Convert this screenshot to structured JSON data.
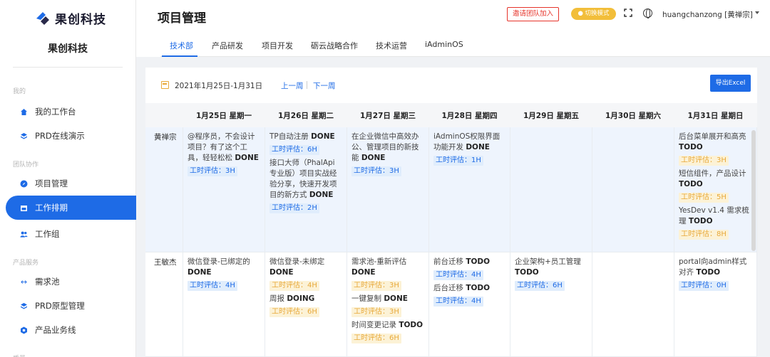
{
  "brand": {
    "logo_text": "果创科技",
    "org_name": "果创科技"
  },
  "sidebar": {
    "groups": [
      {
        "label": "我的",
        "items": [
          {
            "label": "我的工作台",
            "icon": "home-icon"
          },
          {
            "label": "PRD在线演示",
            "icon": "layers-icon"
          }
        ]
      },
      {
        "label": "团队协作",
        "items": [
          {
            "label": "项目管理",
            "icon": "compass-icon"
          },
          {
            "label": "工作排期",
            "icon": "calendar-icon",
            "active": true
          },
          {
            "label": "工作组",
            "icon": "group-icon"
          }
        ]
      },
      {
        "label": "产品服务",
        "items": [
          {
            "label": "需求池",
            "icon": "arrows-icon"
          },
          {
            "label": "PRD原型管理",
            "icon": "layers-icon"
          },
          {
            "label": "产品业务线",
            "icon": "hexagon-icon"
          }
        ]
      },
      {
        "label": "质量",
        "items": []
      }
    ]
  },
  "header": {
    "title": "项目管理",
    "invite_label": "邀请团队加入",
    "mode_label": "● 切换模式",
    "user_label": "huangchanzong [黄禅宗]"
  },
  "tabs": [
    "技术部",
    "产品研发",
    "项目开发",
    "砺云战略合作",
    "技术运营",
    "iAdminOS"
  ],
  "toolbar": {
    "date_range": "2021年1月25日-1月31日",
    "prev_week": "上一周",
    "next_week": "下一周",
    "export_label": "导出Excel"
  },
  "columns": [
    "1月25日 星期一",
    "1月26日 星期二",
    "1月27日 星期三",
    "1月28日 星期四",
    "1月29日 星期五",
    "1月30日 星期六",
    "1月31日 星期日"
  ],
  "rows": [
    {
      "name": "黄禅宗",
      "days": [
        [
          {
            "title": "@程序员，不会设计项目？有了这个工具，轻轻松松",
            "status": "DONE",
            "estimate": "工时评估：3H",
            "color": "blue"
          }
        ],
        [
          {
            "title": "TP自动注册",
            "status": "DONE",
            "estimate": "工时评估：6H",
            "color": "blue"
          },
          {
            "title": "接口大师（PhalApi专业版）项目实战经验分享，快速开发项目的新方式",
            "status": "DONE",
            "estimate": "工时评估：2H",
            "color": "blue"
          }
        ],
        [
          {
            "title": "在企业微信中高效办公、管理项目的新技能",
            "status": "DONE",
            "estimate": "工时评估：3H",
            "color": "blue"
          }
        ],
        [
          {
            "title": "iAdminOS权限界面功能开发",
            "status": "DONE",
            "estimate": "工时评估：1H",
            "color": "blue"
          }
        ],
        [],
        [],
        [
          {
            "title": "后台菜单展开和高亮",
            "status": "TODO",
            "estimate": "工时评估：3H",
            "color": "yellow"
          },
          {
            "title": "短信组件，产品设计",
            "status": "TODO",
            "estimate": "工时评估：5H",
            "color": "yellow"
          },
          {
            "title": "YesDev v1.4 需求梳理",
            "status": "TODO",
            "estimate": "工时评估：8H",
            "color": "yellow"
          }
        ]
      ]
    },
    {
      "name": "王敏杰",
      "days": [
        [
          {
            "title": "微信登录-已绑定的",
            "status": "DONE",
            "estimate": "工时评估：4H",
            "color": "blue"
          }
        ],
        [
          {
            "title": "微信登录-未绑定",
            "status": "DONE",
            "estimate": "工时评估：4H",
            "color": "yellow"
          },
          {
            "title": "周报",
            "status": "DOING",
            "estimate": "工时评估：6H",
            "color": "yellow"
          }
        ],
        [
          {
            "title": "需求池-重新评估",
            "status": "DONE",
            "estimate": "工时评估：3H",
            "color": "yellow"
          },
          {
            "title": "一键复制",
            "status": "DONE",
            "estimate": "工时评估：3H",
            "color": "yellow"
          },
          {
            "title": "时间变更记录",
            "status": "TODO",
            "estimate": "工时评估：6H",
            "color": "yellow"
          }
        ],
        [
          {
            "title": "前台迁移",
            "status": "TODO",
            "estimate": "工时评估：4H",
            "color": "blue"
          },
          {
            "title": "后台迁移",
            "status": "TODO",
            "estimate": "工时评估：4H",
            "color": "blue"
          }
        ],
        [
          {
            "title": "企业架构+员工管理",
            "status": "TODO",
            "estimate": "工时评估：6H",
            "color": "blue"
          }
        ],
        [],
        [
          {
            "title": "portal向admin样式对齐",
            "status": "TODO",
            "estimate": "工时评估：0H",
            "color": "blue"
          }
        ]
      ]
    }
  ],
  "colors": {
    "accent": "#1E6BE6",
    "danger": "#e6332a",
    "warning": "#e8a93a",
    "row_highlight": "#eef4fd"
  }
}
